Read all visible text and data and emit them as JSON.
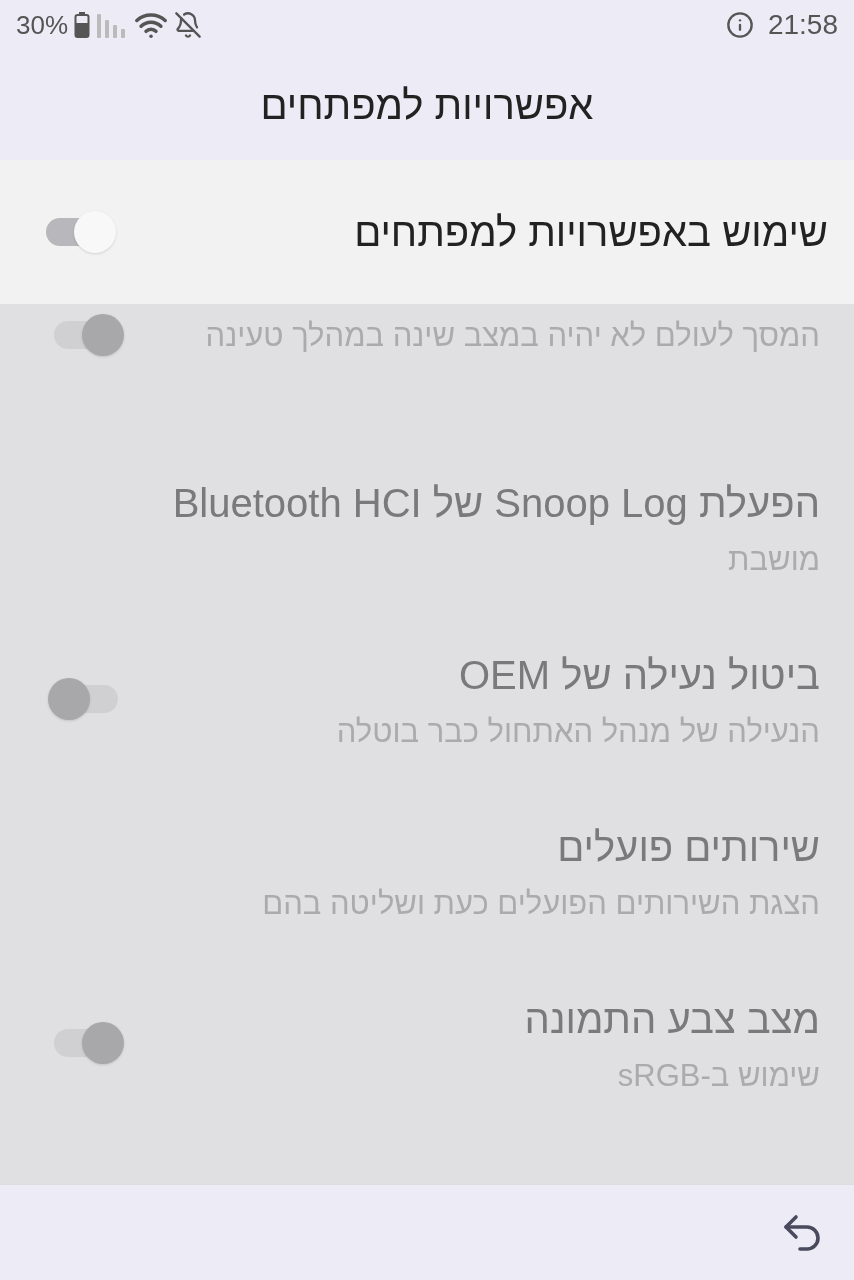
{
  "status_bar": {
    "battery": "30%",
    "time": "21:58"
  },
  "header": {
    "title": "אפשרויות למפתחים"
  },
  "master": {
    "label": "שימוש באפשרויות למפתחים",
    "on": false
  },
  "items": [
    {
      "kind": "switch",
      "summary": "המסך לעולם לא יהיה במצב שינה במהלך טעינה",
      "on": false
    },
    {
      "kind": "plain",
      "title": "הפעלת Snoop Log של Bluetooth HCI",
      "summary": "מושבת"
    },
    {
      "kind": "switch",
      "title": "ביטול נעילה של OEM",
      "summary": "הנעילה של מנהל האתחול כבר בוטלה",
      "on": true
    },
    {
      "kind": "plain",
      "title": "שירותים פועלים",
      "summary": "הצגת השירותים הפועלים כעת ושליטה בהם"
    },
    {
      "kind": "switch",
      "title": "מצב צבע התמונה",
      "summary": "שימוש ב-sRGB",
      "on": false
    }
  ]
}
